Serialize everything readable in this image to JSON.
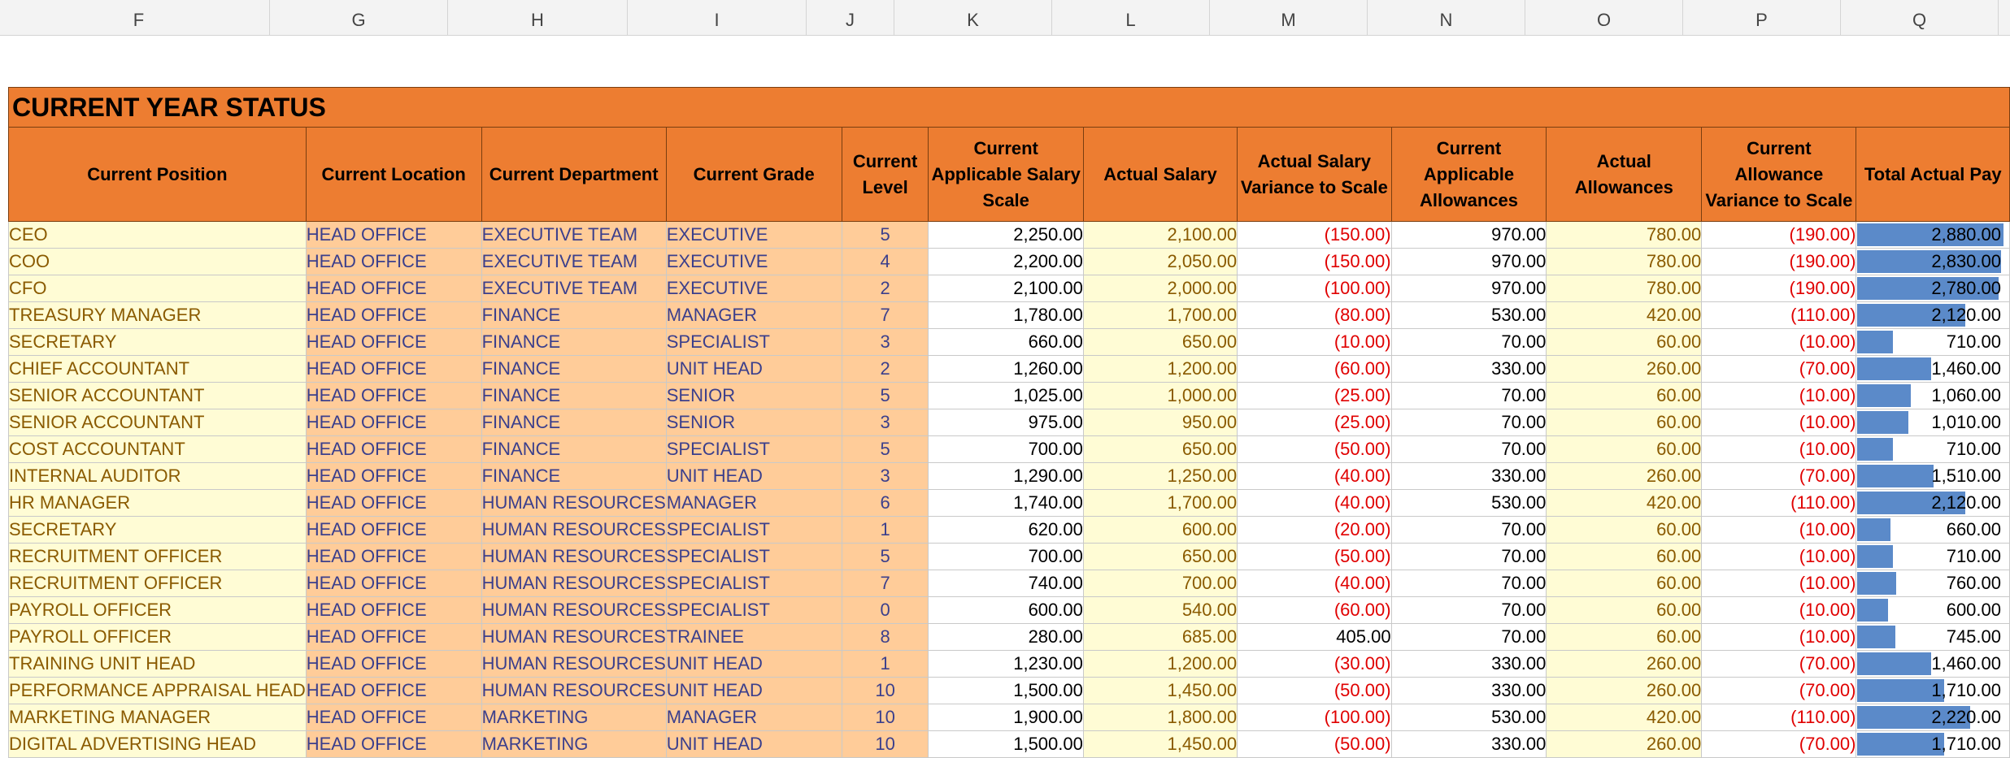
{
  "columns": [
    "F",
    "G",
    "H",
    "I",
    "J",
    "K",
    "L",
    "M",
    "N",
    "O",
    "P",
    "Q"
  ],
  "title": "CURRENT YEAR STATUS",
  "headers": [
    "Current Position",
    "Current Location",
    "Current Department",
    "Current Grade",
    "Current Level",
    "Current Applicable Salary Scale",
    "Actual Salary",
    "Actual Salary Variance to Scale",
    "Current Applicable Allowances",
    "Actual Allowances",
    "Current Allowance Variance to Scale",
    "Total Actual Pay"
  ],
  "colors": {
    "header_fill": "#ed7d31",
    "position_fill": "#fffcd5",
    "org_fill": "#ffcc99",
    "negative_text": "#e00000",
    "databar": "#5b8ac9"
  },
  "databar_max": 2880,
  "rows": [
    {
      "position": "CEO",
      "location": "HEAD OFFICE",
      "department": "EXECUTIVE TEAM",
      "grade": "EXECUTIVE",
      "level": "5",
      "scale": "2,250.00",
      "actual_salary": "2,100.00",
      "salary_variance": "(150.00)",
      "allowances": "970.00",
      "actual_allowances": "780.00",
      "allowance_variance": "(190.00)",
      "total": "2,880.00",
      "total_value": 2880
    },
    {
      "position": "COO",
      "location": "HEAD OFFICE",
      "department": "EXECUTIVE TEAM",
      "grade": "EXECUTIVE",
      "level": "4",
      "scale": "2,200.00",
      "actual_salary": "2,050.00",
      "salary_variance": "(150.00)",
      "allowances": "970.00",
      "actual_allowances": "780.00",
      "allowance_variance": "(190.00)",
      "total": "2,830.00",
      "total_value": 2830
    },
    {
      "position": "CFO",
      "location": "HEAD OFFICE",
      "department": "EXECUTIVE TEAM",
      "grade": "EXECUTIVE",
      "level": "2",
      "scale": "2,100.00",
      "actual_salary": "2,000.00",
      "salary_variance": "(100.00)",
      "allowances": "970.00",
      "actual_allowances": "780.00",
      "allowance_variance": "(190.00)",
      "total": "2,780.00",
      "total_value": 2780
    },
    {
      "position": "TREASURY MANAGER",
      "location": "HEAD OFFICE",
      "department": "FINANCE",
      "grade": "MANAGER",
      "level": "7",
      "scale": "1,780.00",
      "actual_salary": "1,700.00",
      "salary_variance": "(80.00)",
      "allowances": "530.00",
      "actual_allowances": "420.00",
      "allowance_variance": "(110.00)",
      "total": "2,120.00",
      "total_value": 2120
    },
    {
      "position": "SECRETARY",
      "location": "HEAD OFFICE",
      "department": "FINANCE",
      "grade": "SPECIALIST",
      "level": "3",
      "scale": "660.00",
      "actual_salary": "650.00",
      "salary_variance": "(10.00)",
      "allowances": "70.00",
      "actual_allowances": "60.00",
      "allowance_variance": "(10.00)",
      "total": "710.00",
      "total_value": 710
    },
    {
      "position": "CHIEF ACCOUNTANT",
      "location": "HEAD OFFICE",
      "department": "FINANCE",
      "grade": "UNIT HEAD",
      "level": "2",
      "scale": "1,260.00",
      "actual_salary": "1,200.00",
      "salary_variance": "(60.00)",
      "allowances": "330.00",
      "actual_allowances": "260.00",
      "allowance_variance": "(70.00)",
      "total": "1,460.00",
      "total_value": 1460
    },
    {
      "position": "SENIOR ACCOUNTANT",
      "location": "HEAD OFFICE",
      "department": "FINANCE",
      "grade": "SENIOR",
      "level": "5",
      "scale": "1,025.00",
      "actual_salary": "1,000.00",
      "salary_variance": "(25.00)",
      "allowances": "70.00",
      "actual_allowances": "60.00",
      "allowance_variance": "(10.00)",
      "total": "1,060.00",
      "total_value": 1060
    },
    {
      "position": "SENIOR ACCOUNTANT",
      "location": "HEAD OFFICE",
      "department": "FINANCE",
      "grade": "SENIOR",
      "level": "3",
      "scale": "975.00",
      "actual_salary": "950.00",
      "salary_variance": "(25.00)",
      "allowances": "70.00",
      "actual_allowances": "60.00",
      "allowance_variance": "(10.00)",
      "total": "1,010.00",
      "total_value": 1010
    },
    {
      "position": "COST ACCOUNTANT",
      "location": "HEAD OFFICE",
      "department": "FINANCE",
      "grade": "SPECIALIST",
      "level": "5",
      "scale": "700.00",
      "actual_salary": "650.00",
      "salary_variance": "(50.00)",
      "allowances": "70.00",
      "actual_allowances": "60.00",
      "allowance_variance": "(10.00)",
      "total": "710.00",
      "total_value": 710
    },
    {
      "position": "INTERNAL AUDITOR",
      "location": "HEAD OFFICE",
      "department": "FINANCE",
      "grade": "UNIT HEAD",
      "level": "3",
      "scale": "1,290.00",
      "actual_salary": "1,250.00",
      "salary_variance": "(40.00)",
      "allowances": "330.00",
      "actual_allowances": "260.00",
      "allowance_variance": "(70.00)",
      "total": "1,510.00",
      "total_value": 1510
    },
    {
      "position": "HR MANAGER",
      "location": "HEAD OFFICE",
      "department": "HUMAN RESOURCES",
      "grade": "MANAGER",
      "level": "6",
      "scale": "1,740.00",
      "actual_salary": "1,700.00",
      "salary_variance": "(40.00)",
      "allowances": "530.00",
      "actual_allowances": "420.00",
      "allowance_variance": "(110.00)",
      "total": "2,120.00",
      "total_value": 2120
    },
    {
      "position": "SECRETARY",
      "location": "HEAD OFFICE",
      "department": "HUMAN RESOURCES",
      "grade": "SPECIALIST",
      "level": "1",
      "scale": "620.00",
      "actual_salary": "600.00",
      "salary_variance": "(20.00)",
      "allowances": "70.00",
      "actual_allowances": "60.00",
      "allowance_variance": "(10.00)",
      "total": "660.00",
      "total_value": 660
    },
    {
      "position": "RECRUITMENT OFFICER",
      "location": "HEAD OFFICE",
      "department": "HUMAN RESOURCES",
      "grade": "SPECIALIST",
      "level": "5",
      "scale": "700.00",
      "actual_salary": "650.00",
      "salary_variance": "(50.00)",
      "allowances": "70.00",
      "actual_allowances": "60.00",
      "allowance_variance": "(10.00)",
      "total": "710.00",
      "total_value": 710
    },
    {
      "position": "RECRUITMENT OFFICER",
      "location": "HEAD OFFICE",
      "department": "HUMAN RESOURCES",
      "grade": "SPECIALIST",
      "level": "7",
      "scale": "740.00",
      "actual_salary": "700.00",
      "salary_variance": "(40.00)",
      "allowances": "70.00",
      "actual_allowances": "60.00",
      "allowance_variance": "(10.00)",
      "total": "760.00",
      "total_value": 760
    },
    {
      "position": "PAYROLL OFFICER",
      "location": "HEAD OFFICE",
      "department": "HUMAN RESOURCES",
      "grade": "SPECIALIST",
      "level": "0",
      "scale": "600.00",
      "actual_salary": "540.00",
      "salary_variance": "(60.00)",
      "allowances": "70.00",
      "actual_allowances": "60.00",
      "allowance_variance": "(10.00)",
      "total": "600.00",
      "total_value": 600
    },
    {
      "position": "PAYROLL OFFICER",
      "location": "HEAD OFFICE",
      "department": "HUMAN RESOURCES",
      "grade": "TRAINEE",
      "level": "8",
      "scale": "280.00",
      "actual_salary": "685.00",
      "salary_variance": "405.00",
      "allowances": "70.00",
      "actual_allowances": "60.00",
      "allowance_variance": "(10.00)",
      "total": "745.00",
      "total_value": 745
    },
    {
      "position": "TRAINING UNIT HEAD",
      "location": "HEAD OFFICE",
      "department": "HUMAN RESOURCES",
      "grade": "UNIT HEAD",
      "level": "1",
      "scale": "1,230.00",
      "actual_salary": "1,200.00",
      "salary_variance": "(30.00)",
      "allowances": "330.00",
      "actual_allowances": "260.00",
      "allowance_variance": "(70.00)",
      "total": "1,460.00",
      "total_value": 1460
    },
    {
      "position": "PERFORMANCE APPRAISAL HEAD",
      "location": "HEAD OFFICE",
      "department": "HUMAN RESOURCES",
      "grade": "UNIT HEAD",
      "level": "10",
      "scale": "1,500.00",
      "actual_salary": "1,450.00",
      "salary_variance": "(50.00)",
      "allowances": "330.00",
      "actual_allowances": "260.00",
      "allowance_variance": "(70.00)",
      "total": "1,710.00",
      "total_value": 1710
    },
    {
      "position": "MARKETING MANAGER",
      "location": "HEAD OFFICE",
      "department": "MARKETING",
      "grade": "MANAGER",
      "level": "10",
      "scale": "1,900.00",
      "actual_salary": "1,800.00",
      "salary_variance": "(100.00)",
      "allowances": "530.00",
      "actual_allowances": "420.00",
      "allowance_variance": "(110.00)",
      "total": "2,220.00",
      "total_value": 2220
    },
    {
      "position": "DIGITAL ADVERTISING HEAD",
      "location": "HEAD OFFICE",
      "department": "MARKETING",
      "grade": "UNIT HEAD",
      "level": "10",
      "scale": "1,500.00",
      "actual_salary": "1,450.00",
      "salary_variance": "(50.00)",
      "allowances": "330.00",
      "actual_allowances": "260.00",
      "allowance_variance": "(70.00)",
      "total": "1,710.00",
      "total_value": 1710
    }
  ]
}
